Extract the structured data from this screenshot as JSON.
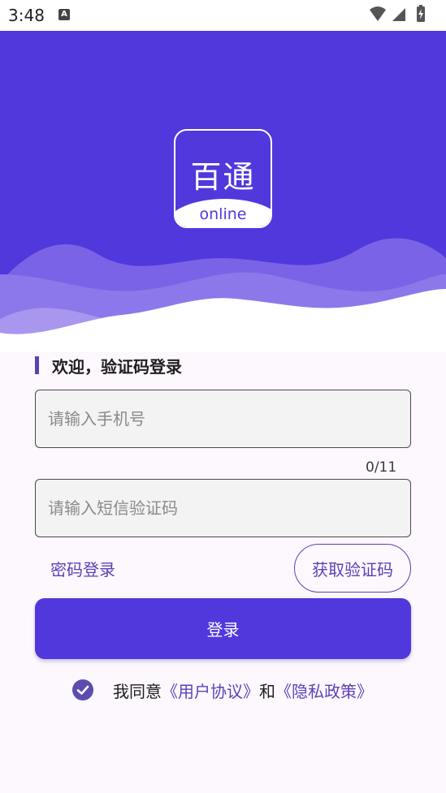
{
  "status_bar": {
    "time": "3:48",
    "notification_icon": "A"
  },
  "logo": {
    "title": "百通",
    "subtitle": "online"
  },
  "form": {
    "heading": "欢迎，验证码登录",
    "phone_placeholder": "请输入手机号",
    "phone_counter": "0/11",
    "code_placeholder": "请输入短信验证码",
    "password_login_label": "密码登录",
    "get_code_label": "获取验证码",
    "login_label": "登录"
  },
  "agreement": {
    "prefix": "我同意",
    "user_agreement": "《用户协议》",
    "conjunction": "和",
    "privacy_policy": "《隐私政策》",
    "checked": true
  },
  "colors": {
    "primary": "#5038dc",
    "accent": "#5e3fb6",
    "background": "#fdf8fd"
  },
  "icons": [
    "wifi-icon",
    "cellular-signal-icon",
    "battery-charging-icon",
    "checkmark-icon"
  ]
}
